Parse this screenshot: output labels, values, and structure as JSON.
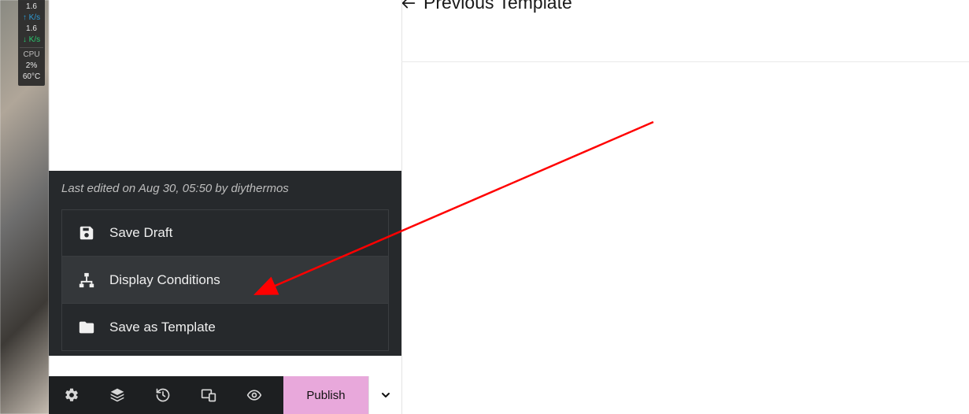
{
  "system_widget": {
    "up_rate_value": "1.6",
    "up_rate_unit": "K/s",
    "down_rate_value": "1.6",
    "down_rate_unit": "K/s",
    "cpu_label": "CPU",
    "cpu_pct": "2%",
    "cpu_temp": "60°C"
  },
  "top_link": {
    "label": "Previous Template"
  },
  "editor": {
    "meta": "Last edited on Aug 30, 05:50 by diythermos",
    "items": [
      {
        "icon": "save-icon",
        "label": "Save Draft"
      },
      {
        "icon": "sitemap-icon",
        "label": "Display Conditions"
      },
      {
        "icon": "folder-icon",
        "label": "Save as Template"
      }
    ]
  },
  "toolbar": {
    "icons": [
      "gear-icon",
      "layers-icon",
      "history-icon",
      "responsive-icon",
      "preview-icon"
    ],
    "publish_label": "Publish"
  }
}
